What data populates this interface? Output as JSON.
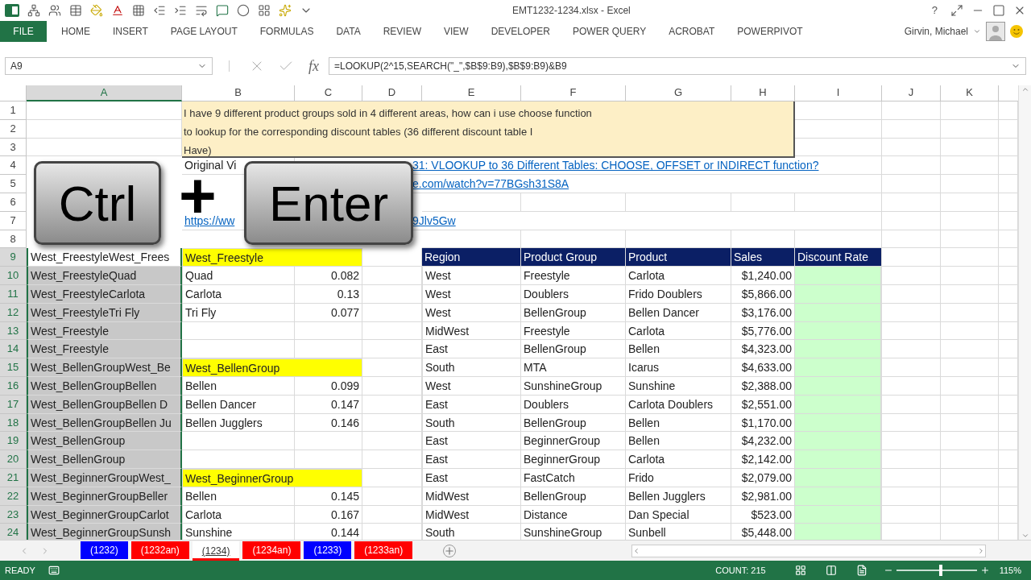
{
  "title_bar": {
    "title": "EMT1232-1234.xlsx - Excel",
    "help": "?"
  },
  "ribbon_tabs": [
    {
      "label": "FILE",
      "kind": "file"
    },
    {
      "label": "HOME",
      "kind": "tab"
    },
    {
      "label": "INSERT",
      "kind": "tab"
    },
    {
      "label": "PAGE LAYOUT",
      "kind": "tab"
    },
    {
      "label": "FORMULAS",
      "kind": "tab"
    },
    {
      "label": "DATA",
      "kind": "tab"
    },
    {
      "label": "REVIEW",
      "kind": "tab"
    },
    {
      "label": "VIEW",
      "kind": "tab"
    },
    {
      "label": "DEVELOPER",
      "kind": "tab"
    },
    {
      "label": "POWER QUERY",
      "kind": "tab"
    },
    {
      "label": "ACROBAT",
      "kind": "tab"
    },
    {
      "label": "POWERPIVOT",
      "kind": "tab"
    }
  ],
  "account": {
    "user": "Girvin, Michael"
  },
  "formula_bar": {
    "name_box": "A9",
    "function_label": "fx",
    "formula": "=LOOKUP(2^15,SEARCH(\"_\",$B$9:B9),$B$9:B9)&B9"
  },
  "columns": [
    {
      "label": "A",
      "selected": true
    },
    {
      "label": "B",
      "selected": false
    },
    {
      "label": "C",
      "selected": false
    },
    {
      "label": "D",
      "selected": false
    },
    {
      "label": "E",
      "selected": false
    },
    {
      "label": "F",
      "selected": false
    },
    {
      "label": "G",
      "selected": false
    },
    {
      "label": "H",
      "selected": false
    },
    {
      "label": "I",
      "selected": false
    },
    {
      "label": "J",
      "selected": false
    },
    {
      "label": "K",
      "selected": false
    }
  ],
  "row_headers": [
    {
      "label": "1",
      "selected": false
    },
    {
      "label": "2",
      "selected": false
    },
    {
      "label": "3",
      "selected": false
    },
    {
      "label": "4",
      "selected": false
    },
    {
      "label": "5",
      "selected": false
    },
    {
      "label": "6",
      "selected": false
    },
    {
      "label": "7",
      "selected": false
    },
    {
      "label": "8",
      "selected": false
    },
    {
      "label": "9",
      "selected": true
    },
    {
      "label": "10",
      "selected": true
    },
    {
      "label": "11",
      "selected": true
    },
    {
      "label": "12",
      "selected": true
    },
    {
      "label": "13",
      "selected": true
    },
    {
      "label": "14",
      "selected": true
    },
    {
      "label": "15",
      "selected": true
    },
    {
      "label": "16",
      "selected": true
    },
    {
      "label": "17",
      "selected": true
    },
    {
      "label": "18",
      "selected": true
    },
    {
      "label": "19",
      "selected": true
    },
    {
      "label": "20",
      "selected": true
    },
    {
      "label": "21",
      "selected": true
    },
    {
      "label": "22",
      "selected": true
    },
    {
      "label": "23",
      "selected": true
    },
    {
      "label": "24",
      "selected": true
    }
  ],
  "comment": {
    "lines": [
      "I have 9 different product groups sold in 4 different areas, how can i use choose function",
      "to lookup for the corresponding discount tables (36 different discount table I",
      "Have)"
    ]
  },
  "upper_rows": [
    {},
    {},
    {},
    {
      "left": {
        "text": "Original Vi",
        "kind": "plain"
      },
      "right": {
        "text": "31: VLOOKUP to 36 Different Tables: CHOOSE, OFFSET or INDIRECT function?",
        "kind": "link"
      }
    },
    {
      "right": {
        "text": "e.com/watch?v=77BGsh31S8A",
        "kind": "link"
      }
    },
    {},
    {
      "left": {
        "text": "https://ww",
        "kind": "link"
      },
      "right": {
        "text": "9Jlv5Gw",
        "kind": "link"
      }
    },
    {}
  ],
  "keys_overlay": {
    "first": "Ctrl",
    "plus": "+",
    "second": "Enter"
  },
  "lookup_list": [
    {
      "text": "West_FreestyleWest_Frees",
      "active": true
    },
    {
      "text": "West_FreestyleQuad",
      "active": false
    },
    {
      "text": "West_FreestyleCarlota",
      "active": false
    },
    {
      "text": "West_FreestyleTri Fly",
      "active": false
    },
    {
      "text": "West_Freestyle",
      "active": false
    },
    {
      "text": "West_Freestyle",
      "active": false
    },
    {
      "text": "West_BellenGroupWest_Be",
      "active": false
    },
    {
      "text": "West_BellenGroupBellen",
      "active": false
    },
    {
      "text": "West_BellenGroupBellen D",
      "active": false
    },
    {
      "text": "West_BellenGroupBellen Ju",
      "active": false
    },
    {
      "text": "West_BellenGroup",
      "active": false
    },
    {
      "text": "West_BellenGroup",
      "active": false
    },
    {
      "text": "West_BeginnerGroupWest_",
      "active": false
    },
    {
      "text": "West_BeginnerGroupBeller",
      "active": false
    },
    {
      "text": "West_BeginnerGroupCarlot",
      "active": false
    },
    {
      "text": "West_BeginnerGroupSunsh",
      "active": false
    }
  ],
  "discount_tables": [
    {
      "title": "West_Freestyle",
      "items": [
        {
          "product": "Quad",
          "rate": "0.082"
        },
        {
          "product": "Carlota",
          "rate": "0.13"
        },
        {
          "product": "Tri Fly",
          "rate": "0.077"
        }
      ]
    },
    {
      "title": "West_BellenGroup",
      "items": [
        {
          "product": "Bellen",
          "rate": "0.099"
        },
        {
          "product": "Bellen Dancer",
          "rate": "0.147"
        },
        {
          "product": "Bellen Jugglers",
          "rate": "0.146"
        }
      ]
    },
    {
      "title": "West_BeginnerGroup",
      "items": [
        {
          "product": "Bellen",
          "rate": "0.145"
        },
        {
          "product": "Carlota",
          "rate": "0.167"
        },
        {
          "product": "Sunshine",
          "rate": "0.144"
        }
      ]
    }
  ],
  "sales_table": {
    "columns": [
      "Region",
      "Product Group",
      "Product",
      "Sales",
      "Discount Rate"
    ],
    "rows": [
      [
        "West",
        "Freestyle",
        "Carlota",
        "$1,240.00"
      ],
      [
        "West",
        "Doublers",
        "Frido Doublers",
        "$5,866.00"
      ],
      [
        "West",
        "BellenGroup",
        "Bellen Dancer",
        "$3,176.00"
      ],
      [
        "MidWest",
        "Freestyle",
        "Carlota",
        "$5,776.00"
      ],
      [
        "East",
        "BellenGroup",
        "Bellen",
        "$4,323.00"
      ],
      [
        "South",
        "MTA",
        "Icarus",
        "$4,633.00"
      ],
      [
        "West",
        "SunshineGroup",
        "Sunshine",
        "$2,388.00"
      ],
      [
        "East",
        "Doublers",
        "Carlota Doublers",
        "$2,551.00"
      ],
      [
        "South",
        "BellenGroup",
        "Bellen",
        "$1,170.00"
      ],
      [
        "East",
        "BeginnerGroup",
        "Bellen",
        "$4,232.00"
      ],
      [
        "East",
        "BeginnerGroup",
        "Carlota",
        "$2,142.00"
      ],
      [
        "East",
        "FastCatch",
        "Frido",
        "$2,079.00"
      ],
      [
        "MidWest",
        "BellenGroup",
        "Bellen Jugglers",
        "$2,981.00"
      ],
      [
        "MidWest",
        "Distance",
        "Dan Special",
        "$523.00"
      ],
      [
        "South",
        "SunshineGroup",
        "Sunbell",
        "$5,448.00"
      ]
    ]
  },
  "sheet_tabs": [
    {
      "label": "(1232)",
      "color": "#0000ff",
      "selected": false
    },
    {
      "label": "(1232an)",
      "color": "#ff0000",
      "selected": false
    },
    {
      "label": "(1234)",
      "color": "#ff0000",
      "selected": true
    },
    {
      "label": "(1234an)",
      "color": "#ff0000",
      "selected": false
    },
    {
      "label": "(1233)",
      "color": "#0000ff",
      "selected": false
    },
    {
      "label": "(1233an)",
      "color": "#ff0000",
      "selected": false
    }
  ],
  "status_bar": {
    "mode": "READY",
    "count": "COUNT: 215",
    "zoom": "115%",
    "zoom_slider": {
      "level": 0.55
    }
  }
}
